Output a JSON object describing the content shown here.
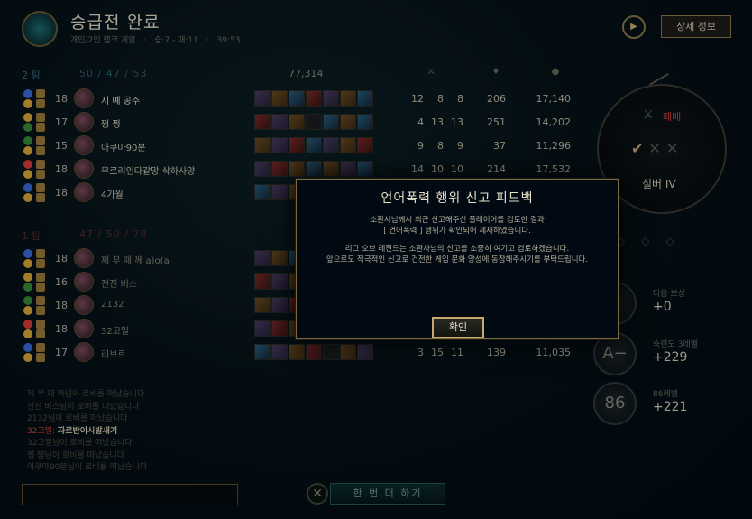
{
  "header": {
    "title": "승급전 완료",
    "game_mode": "개인/2인 랭크 게임",
    "series_record": "승:7 - 패:11",
    "duration": "39:53",
    "detail_button": "상세 정보"
  },
  "team1": {
    "name": "2 팀",
    "kda": "50 / 47 / 53",
    "gold": "77,314",
    "players": [
      {
        "level": "18",
        "name": "지 예 공주",
        "k": "12",
        "d": "8",
        "a": "8",
        "cs": "206",
        "gold": "17,140"
      },
      {
        "level": "17",
        "name": "쩡 쩡",
        "k": "4",
        "d": "13",
        "a": "13",
        "cs": "251",
        "gold": "14,202"
      },
      {
        "level": "15",
        "name": "아쿠마90분",
        "k": "9",
        "d": "8",
        "a": "9",
        "cs": "37",
        "gold": "11,296"
      },
      {
        "level": "18",
        "name": "무르리인다같망 삭하사양",
        "k": "14",
        "d": "10",
        "a": "10",
        "cs": "214",
        "gold": "17,532"
      },
      {
        "level": "18",
        "name": "4가월",
        "k": "",
        "d": "",
        "a": "",
        "cs": "",
        "gold": ""
      }
    ]
  },
  "team2": {
    "name": "1 팀",
    "kda": "47 / 50 / 78",
    "players": [
      {
        "level": "18",
        "name": "제 무 때 께 a)o(a",
        "k": "",
        "d": "",
        "a": "",
        "cs": "",
        "gold": ""
      },
      {
        "level": "16",
        "name": "전진 버스",
        "k": "",
        "d": "",
        "a": "",
        "cs": "",
        "gold": ""
      },
      {
        "level": "18",
        "name": "2132",
        "k": "",
        "d": "",
        "a": "",
        "cs": "",
        "gold": ""
      },
      {
        "level": "18",
        "name": "32고밀",
        "k": "",
        "d": "",
        "a": "",
        "cs": "",
        "gold": ""
      },
      {
        "level": "17",
        "name": "리브르",
        "k": "3",
        "d": "15",
        "a": "11",
        "cs": "139",
        "gold": "11,035"
      }
    ]
  },
  "right_panel": {
    "result": "패배",
    "rank": "실버 IV",
    "rewards": [
      {
        "circle": "",
        "label": "다음 보상",
        "value": "+0"
      },
      {
        "circle": "A−",
        "label": "숙련도 3레벨",
        "value": "+229"
      },
      {
        "circle": "86",
        "label": "86레벨",
        "value": "+221"
      }
    ]
  },
  "chat": {
    "lines": [
      "제 무 때 까넘이 로비를 떠났습니다",
      "전진 버스님이 로비를 떠났습니다",
      "2132님이 로비를 떠났습니다",
      "32고밀님이 로비를 떠났습니다",
      "쩡 쩡님이 로비를 떠났습니다",
      "아쿠마90분님이 로비를 떠났습니다"
    ],
    "highlight_prefix": "32고밀:",
    "highlight_message": "자르반이시발새기"
  },
  "play_again": "한 번 더 하기",
  "modal": {
    "title": "언어폭력 행위 신고 피드백",
    "line1": "소환사님께서 최근 신고해주신 플레이어를 검토한 결과",
    "line2": "[ 언어폭력 ] 행위가 확인되어 제재하였습니다.",
    "line3": "리그 오브 레전드는 소환사님의 신고를 소중히 여기고 검토하겠습니다.",
    "line4": "앞으로도 적극적인 신고로 건전한 게임 문화 양성에 동참해주시기를 부탁드립니다.",
    "confirm": "확인"
  },
  "colors": {
    "accent_gold": "#c8aa6e",
    "defeat_red": "#c8463a",
    "background": "#010a13"
  },
  "icons": [
    "search-icon",
    "replay-icon",
    "sword-icon",
    "check-icon",
    "close-icon",
    "gold-icon",
    "minion-icon"
  ]
}
